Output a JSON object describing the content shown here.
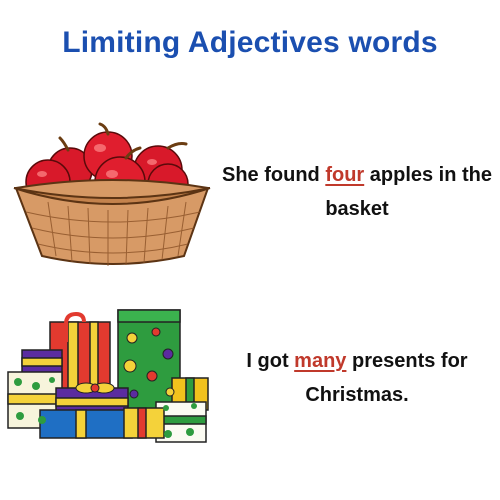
{
  "title": "Limiting Adjectives words",
  "examples": [
    {
      "before": "She found ",
      "highlight": "four",
      "after": " apples in the basket",
      "image": "apple-basket-illustration"
    },
    {
      "before": "I got ",
      "highlight": "many",
      "after": " presents for Christmas.",
      "image": "christmas-presents-illustration"
    }
  ],
  "colors": {
    "title": "#1b4fb0",
    "highlight": "#c0392b",
    "text": "#111111"
  }
}
